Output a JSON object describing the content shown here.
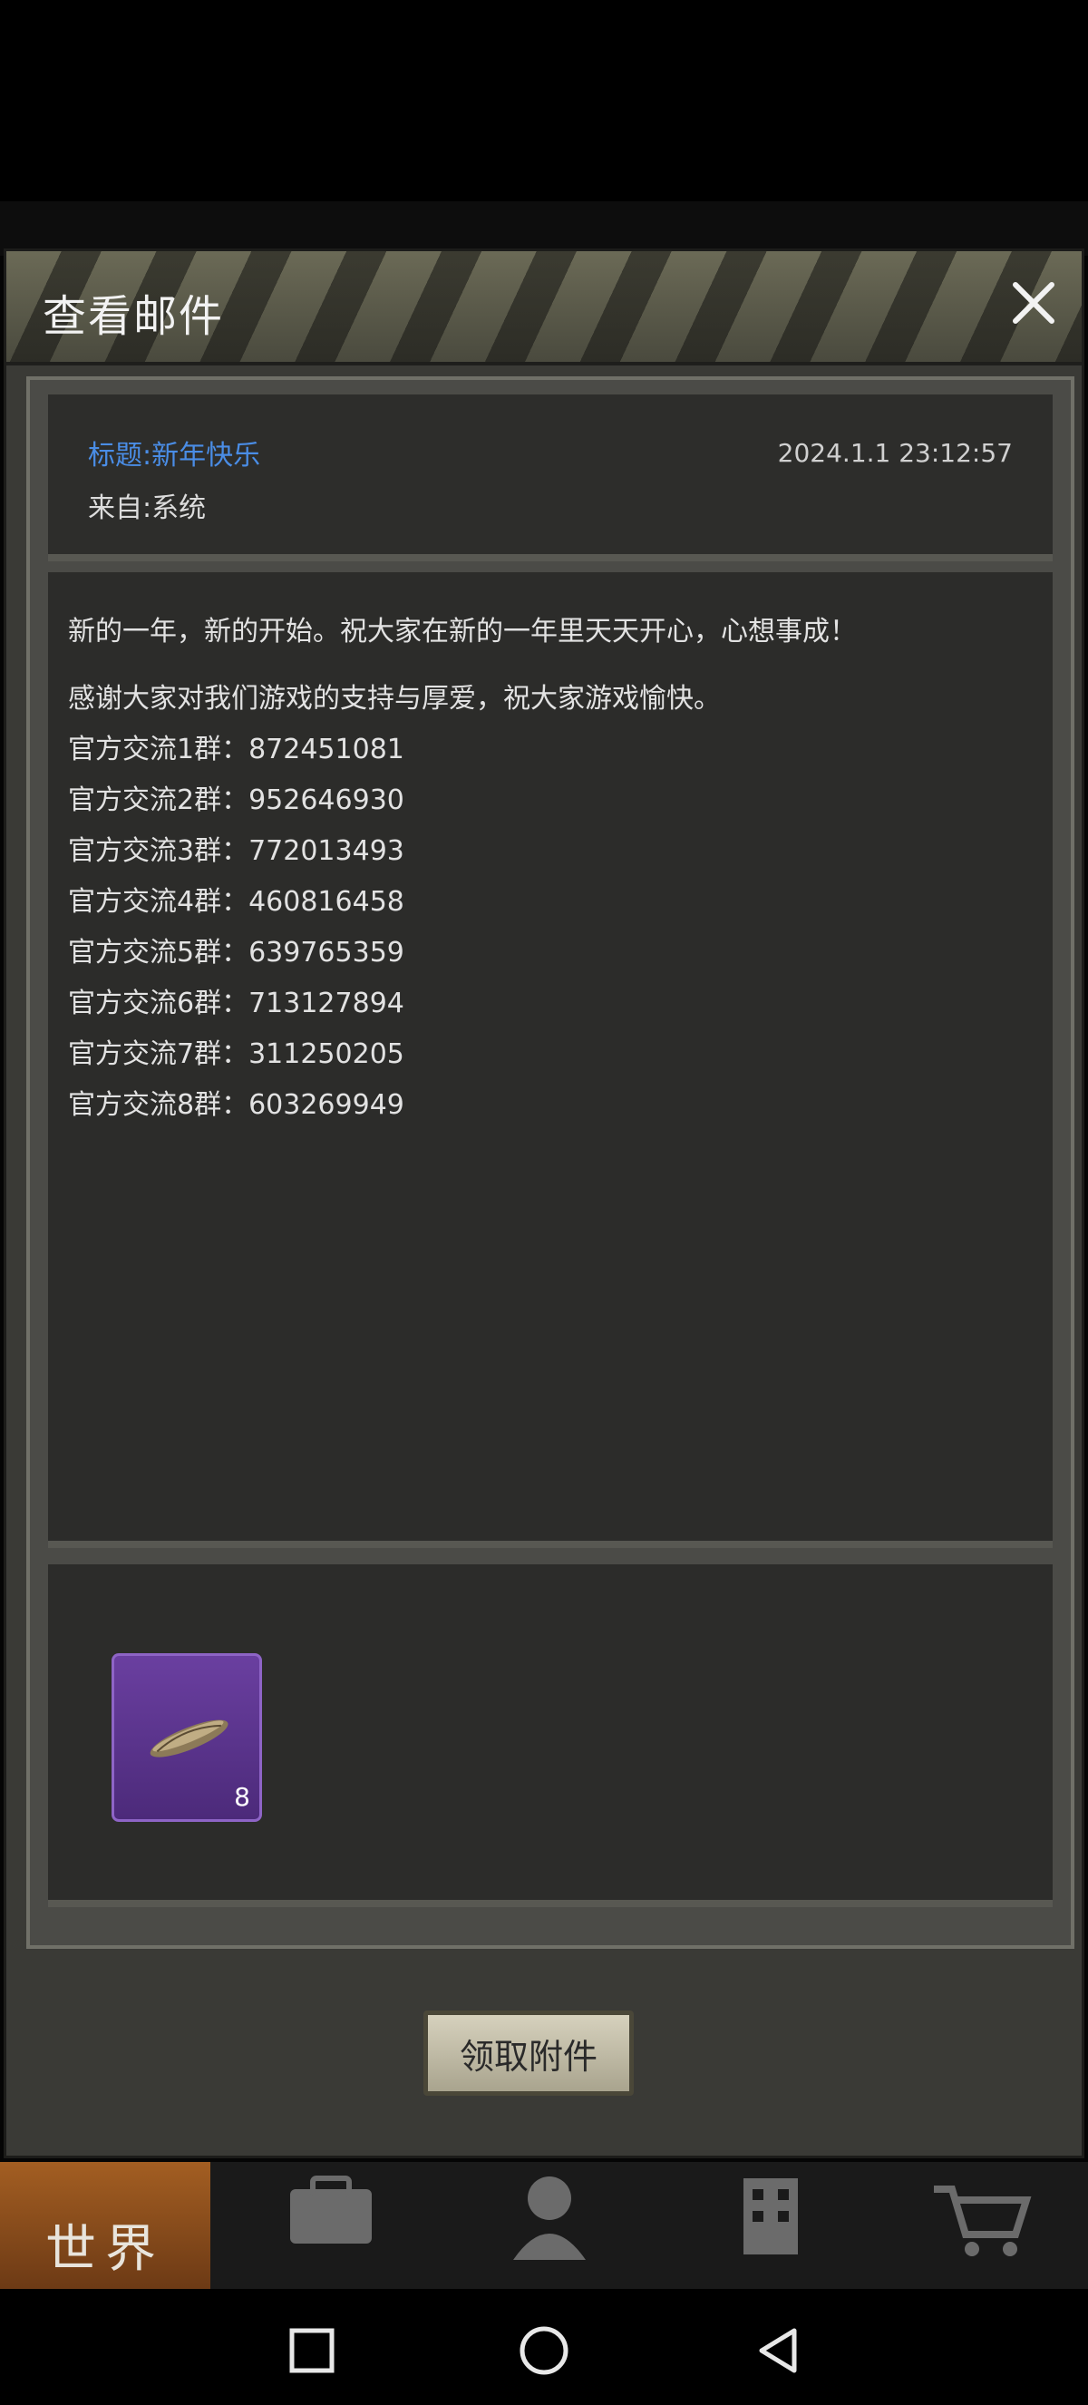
{
  "modal": {
    "title": "查看邮件",
    "close_icon": "close-icon"
  },
  "mail": {
    "subject": "标题:新年快乐",
    "from": "来自:系统",
    "time": "2024.1.1 23:12:57",
    "body": [
      "新的一年，新的开始。祝大家在新的一年里天天开心，心想事成！",
      "感谢大家对我们游戏的支持与厚爱，祝大家游戏愉快。",
      "官方交流1群：872451081",
      "官方交流2群：952646930",
      "官方交流3群：772013493",
      "官方交流4群：460816458",
      "官方交流5群：639765359",
      "官方交流6群：713127894",
      "官方交流7群：311250205",
      "官方交流8群：603269949"
    ]
  },
  "attachment": {
    "icon": "bread-stick-item-icon",
    "count": "8",
    "rarity_color": "#6a3fa0"
  },
  "actions": {
    "claim_label": "领取附件"
  },
  "game_nav": {
    "world_label": "世界",
    "icons": [
      "backpack-icon",
      "character-icon",
      "building-icon",
      "cart-icon"
    ]
  },
  "system_nav": {
    "icons": [
      "recent-apps-icon",
      "home-icon",
      "back-icon"
    ]
  }
}
